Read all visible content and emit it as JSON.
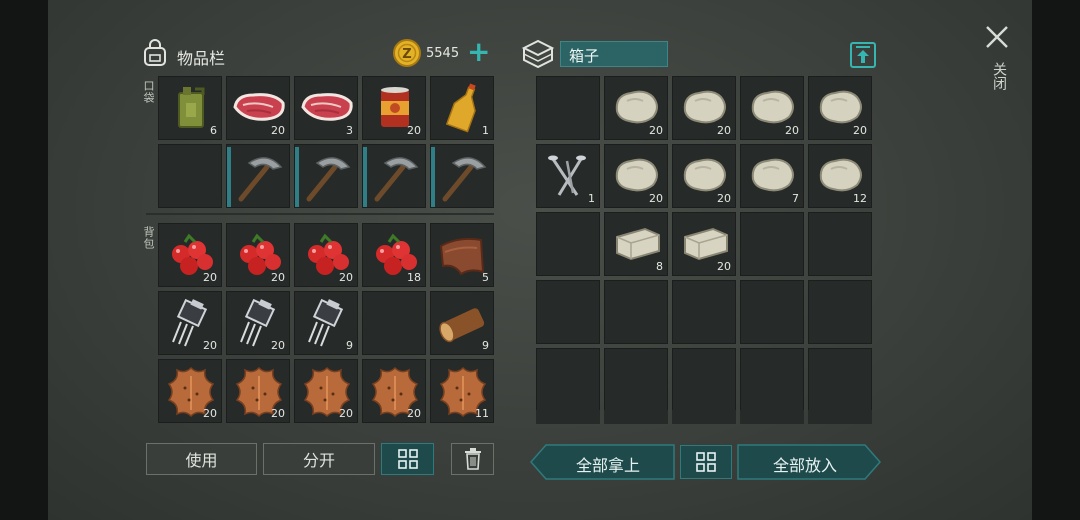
{
  "inventory": {
    "title": "物品栏",
    "coins": "5545",
    "plus": "+",
    "pocket_label": "口袋",
    "backpack_label": "背包",
    "pocket_slots": [
      {
        "item": "fuel-canister",
        "qty": "6"
      },
      {
        "item": "raw-meat",
        "qty": "20"
      },
      {
        "item": "raw-meat",
        "qty": "3"
      },
      {
        "item": "canned-food",
        "qty": "20"
      },
      {
        "item": "oil-bottle",
        "qty": "1"
      },
      {
        "item": "empty",
        "qty": ""
      },
      {
        "item": "pickaxe",
        "qty": ""
      },
      {
        "item": "pickaxe",
        "qty": ""
      },
      {
        "item": "pickaxe",
        "qty": ""
      },
      {
        "item": "pickaxe",
        "qty": ""
      }
    ],
    "backpack_slots": [
      {
        "item": "berries",
        "qty": "20"
      },
      {
        "item": "berries",
        "qty": "20"
      },
      {
        "item": "berries",
        "qty": "20"
      },
      {
        "item": "berries",
        "qty": "18"
      },
      {
        "item": "leather",
        "qty": "5"
      },
      {
        "item": "transistor",
        "qty": "20"
      },
      {
        "item": "transistor",
        "qty": "20"
      },
      {
        "item": "transistor",
        "qty": "9"
      },
      {
        "item": "empty",
        "qty": ""
      },
      {
        "item": "log",
        "qty": "9"
      },
      {
        "item": "animal-hide",
        "qty": "20"
      },
      {
        "item": "animal-hide",
        "qty": "20"
      },
      {
        "item": "animal-hide",
        "qty": "20"
      },
      {
        "item": "animal-hide",
        "qty": "20"
      },
      {
        "item": "animal-hide",
        "qty": "11"
      }
    ],
    "use_button": "使用",
    "split_button": "分开"
  },
  "chest": {
    "name": "箱子",
    "slots": [
      {
        "item": "empty",
        "qty": ""
      },
      {
        "item": "stone",
        "qty": "20"
      },
      {
        "item": "stone",
        "qty": "20"
      },
      {
        "item": "stone",
        "qty": "20"
      },
      {
        "item": "stone",
        "qty": "20"
      },
      {
        "item": "nails",
        "qty": "1"
      },
      {
        "item": "stone",
        "qty": "20"
      },
      {
        "item": "stone",
        "qty": "20"
      },
      {
        "item": "stone",
        "qty": "7"
      },
      {
        "item": "stone",
        "qty": "12"
      },
      {
        "item": "empty",
        "qty": ""
      },
      {
        "item": "stone-block",
        "qty": "8"
      },
      {
        "item": "stone-block",
        "qty": "20"
      },
      {
        "item": "empty",
        "qty": ""
      },
      {
        "item": "empty",
        "qty": ""
      },
      {
        "item": "empty",
        "qty": ""
      },
      {
        "item": "empty",
        "qty": ""
      },
      {
        "item": "empty",
        "qty": ""
      },
      {
        "item": "empty",
        "qty": ""
      },
      {
        "item": "empty",
        "qty": ""
      },
      {
        "item": "empty",
        "qty": ""
      },
      {
        "item": "empty",
        "qty": ""
      },
      {
        "item": "empty",
        "qty": ""
      },
      {
        "item": "empty",
        "qty": ""
      },
      {
        "item": "empty",
        "qty": ""
      }
    ],
    "take_all_button": "全部拿上",
    "put_all_button": "全部放入"
  },
  "close_label": "关闭",
  "colors": {
    "accent": "#2c6466",
    "coin": "#e3b227",
    "plus": "#35b6b0"
  }
}
